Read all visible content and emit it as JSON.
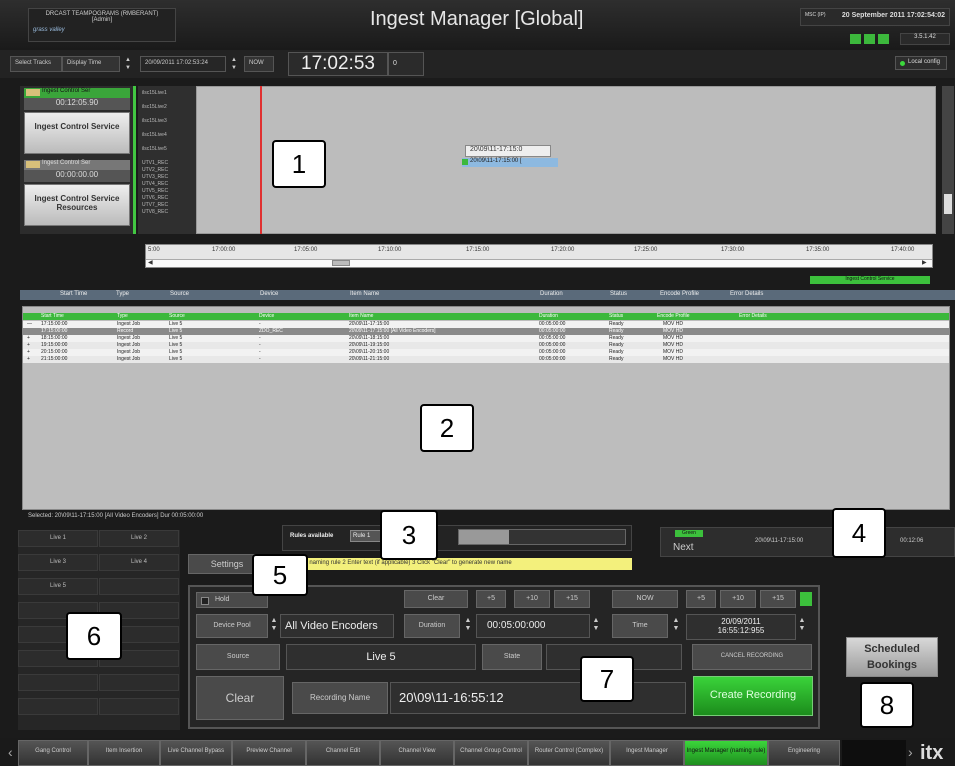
{
  "header": {
    "station": "DRCAST TEAMPOGRAMS (RMBERANT)",
    "user": "[Admin]",
    "logo_text": "grass valley",
    "title": "Ingest Manager [Global]",
    "date": "20 September 2011 17:02:54:02",
    "date_sub": "MSC (IP)",
    "version": "3.5.1.42"
  },
  "toolbar": {
    "select_tracks": "Select Tracks",
    "display_time": "Display Time",
    "time_value": "20/09/2011 17:02:53:24",
    "now": "NOW",
    "clock": "17:02:53",
    "clock_sub": "0",
    "local_config": "Local config"
  },
  "services": [
    {
      "bar": "Ingest Control Ser",
      "time": "00:12:05.90",
      "label": "Ingest Control Service"
    },
    {
      "bar": "Ingest Control Ser",
      "time": "00:00:00.00",
      "label": "Ingest Control Service Resources"
    }
  ],
  "row_labels": [
    "ilsc15Live1",
    "ilsc15Live2",
    "ilsc15Live3",
    "ilsc15Live4",
    "ilsc15Live5",
    "UTV1_REC",
    "UTV2_REC",
    "UTV3_REC",
    "UTV4_REC",
    "UTV5_REC",
    "UTV6_REC",
    "UTV7_REC",
    "UTV8_REC"
  ],
  "timeline": {
    "tooltip": "20\\09\\11-17:15:0",
    "item": "20\\09\\11-17:15:00 ["
  },
  "ruler_ticks": [
    "5:00",
    "17:00:00",
    "17:05:00",
    "17:10:00",
    "17:15:00",
    "17:20:00",
    "17:25:00",
    "17:30:00",
    "17:35:00",
    "17:40:00"
  ],
  "ics_label": "Ingest Control Service",
  "grid": {
    "columns": [
      "Start Time",
      "Type",
      "Source",
      "Device",
      "Item Name",
      "Duration",
      "Status",
      "Encode Profile",
      "Error Details"
    ],
    "rows": [
      [
        "17:15:00:00",
        "Ingest Job",
        "Live 5",
        "-",
        "20\\09\\11-17:15:00",
        "00:05:00:00",
        "Ready",
        "MOV HD",
        ""
      ],
      [
        "17:15:00:00",
        "Record",
        "Live 5",
        "ZDO_REC",
        "20\\09\\11-17:15:00 [All Video Encoders]",
        "00:05:00:00",
        "Ready",
        "MOV HD",
        ""
      ],
      [
        "18:15:00:00",
        "Ingest Job",
        "Live 5",
        "-",
        "20\\09\\11-18:15:00",
        "00:05:00:00",
        "Ready",
        "MOV HD",
        ""
      ],
      [
        "19:15:00:00",
        "Ingest Job",
        "Live 5",
        "-",
        "20\\09\\11-19:15:00",
        "00:05:00:00",
        "Ready",
        "MOV HD",
        ""
      ],
      [
        "20:15:00:00",
        "Ingest Job",
        "Live 5",
        "-",
        "20\\09\\11-20:15:00",
        "00:05:00:00",
        "Ready",
        "MOV HD",
        ""
      ],
      [
        "21:15:00:00",
        "Ingest Job",
        "Live 5",
        "-",
        "20\\09\\11-21:15:00",
        "00:05:00:00",
        "Ready",
        "MOV HD",
        ""
      ]
    ],
    "selected": "Selected: 20\\09\\11-17:15:00 [All Video Encoders] Dur 00:05:00:00"
  },
  "live_sources": [
    "Live 1",
    "Live 2",
    "Live 3",
    "Live 4",
    "Live 5"
  ],
  "rules": {
    "label": "Rules available",
    "tab": "Rule 1",
    "settings": "Settings",
    "hint": "1 Select naming rule  2 Enter text (if applicable)  3 Click \"Clear\" to generate new name"
  },
  "next": {
    "led": "Green",
    "label": "Next",
    "time": "20\\09\\11-17:15:00",
    "dur": "00:12:06"
  },
  "form": {
    "hold": "Hold",
    "clear_small": "Clear",
    "plus5": "+5",
    "plus10": "+10",
    "plus15": "+15",
    "now": "NOW",
    "device_pool_label": "Device Pool",
    "device_pool_value": "All Video Encoders",
    "duration_label": "Duration",
    "duration_value": "00:05:00:000",
    "time_label": "Time",
    "time_value_date": "20/09/2011",
    "time_value_time": "16:55:12:955",
    "source_label": "Source",
    "source_value": "Live 5",
    "state_label": "State",
    "cancel_recording": "CANCEL RECORDING",
    "clear": "Clear",
    "recording_name_label": "Recording Name",
    "recording_name_value": "20\\09\\11-16:55:12",
    "create_recording": "Create Recording"
  },
  "scheduled_bookings": "Scheduled Bookings",
  "footer_tabs": [
    "Gang Control",
    "Item Insertion",
    "Live Channel Bypass",
    "Preview Channel",
    "Channel Edit",
    "Channel View",
    "Channel Group Control",
    "Router Control (Complex)",
    "Ingest Manager",
    "Ingest Manager (naming rule)",
    "Engineering"
  ],
  "footer_logo": "itx",
  "callouts": [
    "1",
    "2",
    "3",
    "4",
    "5",
    "6",
    "7",
    "8"
  ]
}
